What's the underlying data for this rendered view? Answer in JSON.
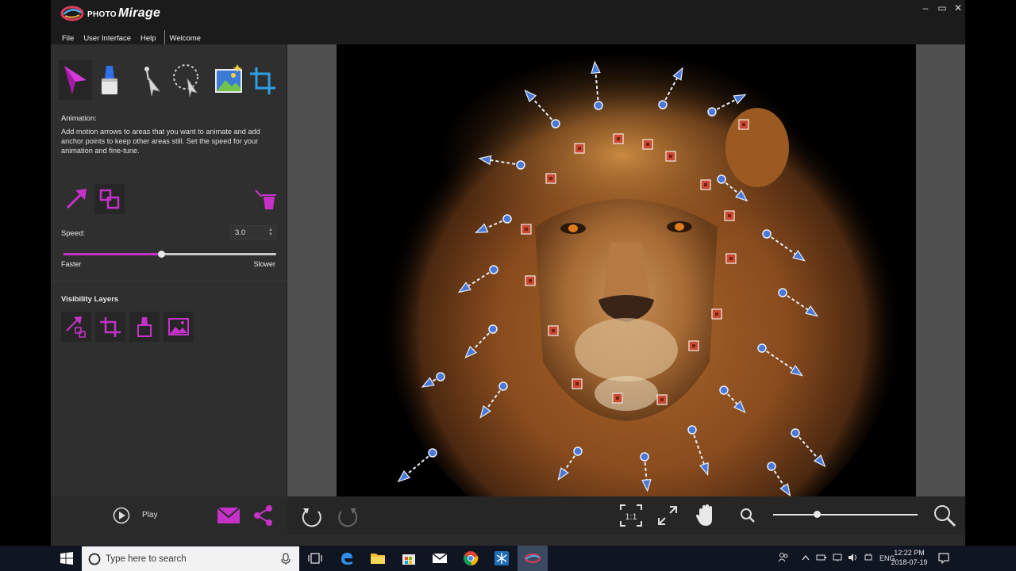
{
  "app": {
    "logo_small": "PHOTO",
    "logo_main": "Mirage"
  },
  "window_controls": {
    "minimize": "–",
    "restore": "▭",
    "close": "✕"
  },
  "menu": {
    "file": "File",
    "user_interface": "User Interface",
    "help": "Help",
    "welcome": "Welcome"
  },
  "tools": [
    "animation-arrow",
    "mask",
    "select-arrow",
    "lasso-select",
    "image",
    "crop"
  ],
  "panel": {
    "title": "Animation:",
    "description": "Add motion arrows to areas that you want to animate and add anchor points to keep other areas still. Set the speed for your animation and fine-tune.",
    "speed_label": "Speed:",
    "speed_value": "3.0",
    "speed_fraction": 0.46,
    "faster": "Faster",
    "slower": "Slower",
    "visibility_title": "Visibility Layers"
  },
  "bottom": {
    "play": "Play",
    "zoom_fraction": 0.28
  },
  "taskbar": {
    "search_placeholder": "Type here to search",
    "lang": "ENG",
    "time": "12:22 PM",
    "date": "2018-07-19"
  },
  "colors": {
    "accent": "#c632c8",
    "anchor": "#c84a32",
    "arrow": "#4a78d8"
  }
}
